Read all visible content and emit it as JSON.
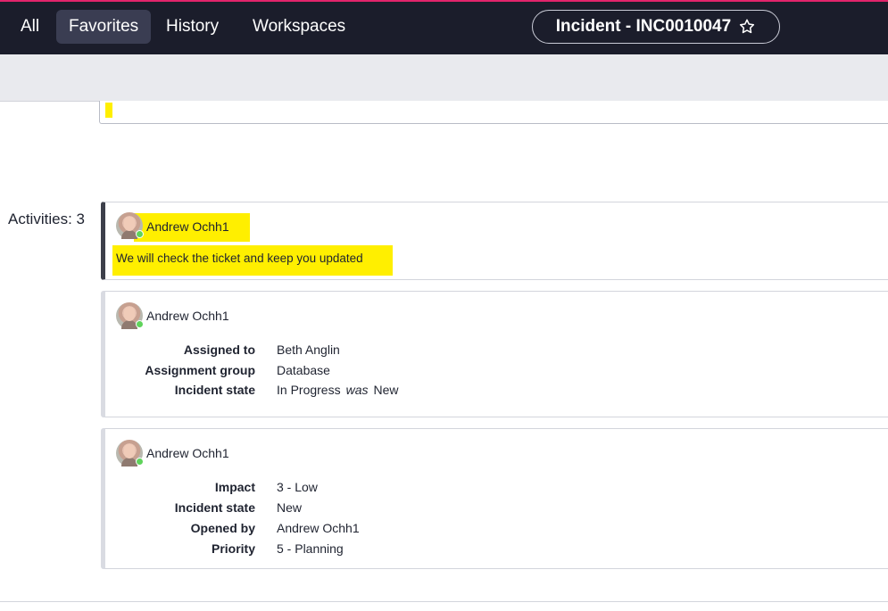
{
  "nav": {
    "items": [
      {
        "label": "All"
      },
      {
        "label": "Favorites",
        "active": true
      },
      {
        "label": "History"
      },
      {
        "label": "Workspaces"
      }
    ],
    "record_title": "Incident - INC0010047",
    "star_icon": "star-outline-icon"
  },
  "activities": {
    "label": "Activities: 3",
    "entries": [
      {
        "type": "comment",
        "author": "Andrew Ochh1",
        "text": "We will check the ticket and keep you updated"
      },
      {
        "type": "field_changes",
        "author": "Andrew Ochh1",
        "fields": [
          {
            "label": "Assigned to",
            "value": "Beth Anglin"
          },
          {
            "label": "Assignment group",
            "value": "Database"
          },
          {
            "label": "Incident state",
            "value": "In Progress",
            "was_word": "was",
            "previous": "New"
          }
        ]
      },
      {
        "type": "field_changes",
        "author": "Andrew Ochh1",
        "fields": [
          {
            "label": "Impact",
            "value": "3 - Low"
          },
          {
            "label": "Incident state",
            "value": "New"
          },
          {
            "label": "Opened by",
            "value": "Andrew Ochh1"
          },
          {
            "label": "Priority",
            "value": "5 - Planning"
          }
        ]
      }
    ]
  },
  "colors": {
    "topbar": "#1b1d2b",
    "accent_top": "#e2246b",
    "highlight": "#ffef00",
    "presence": "#5fd35b"
  }
}
